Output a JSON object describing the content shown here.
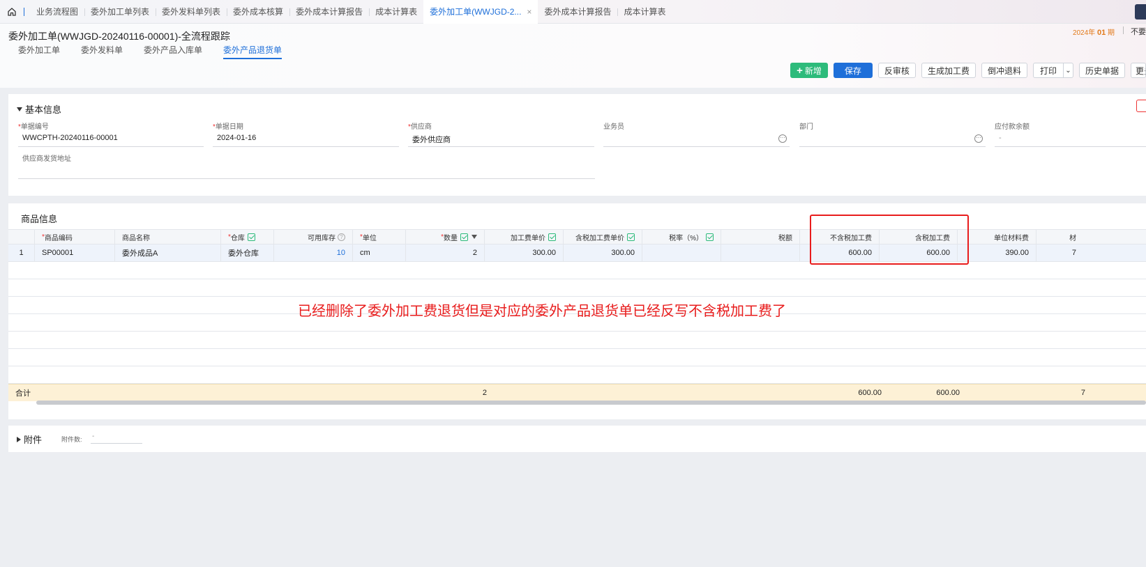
{
  "tabs": [
    {
      "label": "业务流程图"
    },
    {
      "label": "委外加工单列表"
    },
    {
      "label": "委外发料单列表"
    },
    {
      "label": "委外成本核算"
    },
    {
      "label": "委外成本计算报告"
    },
    {
      "label": "成本计算表"
    },
    {
      "label": "委外加工单(WWJGD-2...",
      "active": true,
      "close": "×"
    },
    {
      "label": "委外成本计算报告"
    },
    {
      "label": "成本计算表"
    }
  ],
  "header": {
    "title": "委外加工单(WWJGD-20240116-00001)-全流程跟踪",
    "period_year": "2024年",
    "period_num": "01",
    "period_unit": "期",
    "period_right": "不要"
  },
  "subtabs": [
    "委外加工单",
    "委外发料单",
    "委外产品入库单",
    "委外产品退货单"
  ],
  "toolbar": {
    "add": "新增",
    "save": "保存",
    "unaudit": "反审核",
    "gen_fee": "生成加工费",
    "reverse": "倒冲退料",
    "print": "打印",
    "history": "历史单据",
    "more": "更多"
  },
  "basic": {
    "title": "基本信息",
    "doc_no_label": "单据编号",
    "doc_no": "WWCPTH-20240116-00001",
    "doc_date_label": "单据日期",
    "doc_date": "2024-01-16",
    "supplier_label": "供应商",
    "supplier": "委外供应商",
    "salesman_label": "业务员",
    "salesman": "",
    "dept_label": "部门",
    "dept": "",
    "payable_label": "应付款余额",
    "payable": "-",
    "address_label": "供应商发货地址",
    "address": ""
  },
  "product": {
    "title": "商品信息",
    "columns": [
      "",
      "商品编码",
      "商品名称",
      "仓库",
      "可用库存",
      "单位",
      "数量",
      "加工费单价",
      "含税加工费单价",
      "税率（%）",
      "税额",
      "不含税加工费",
      "含税加工费",
      "单位材料费",
      "材"
    ],
    "rows": [
      [
        "1",
        "SP00001",
        "委外成品A",
        "委外仓库",
        "10",
        "cm",
        "2",
        "300.00",
        "300.00",
        "",
        "",
        "600.00",
        "600.00",
        "390.00",
        "7"
      ]
    ],
    "total": {
      "label": "合计",
      "qty": "2",
      "excl_fee": "600.00",
      "incl_fee": "600.00",
      "last": "7"
    },
    "annotation": "已经删除了委外加工费退货但是对应的委外产品退货单已经反写不含税加工费了"
  },
  "attach": {
    "title": "附件",
    "count_label": "附件数:",
    "count": "-"
  },
  "colors": {
    "accent": "#1e6fd9",
    "green": "#2dbb7b",
    "annotation": "#e81c1c",
    "total_bg": "#fdf1d6"
  }
}
